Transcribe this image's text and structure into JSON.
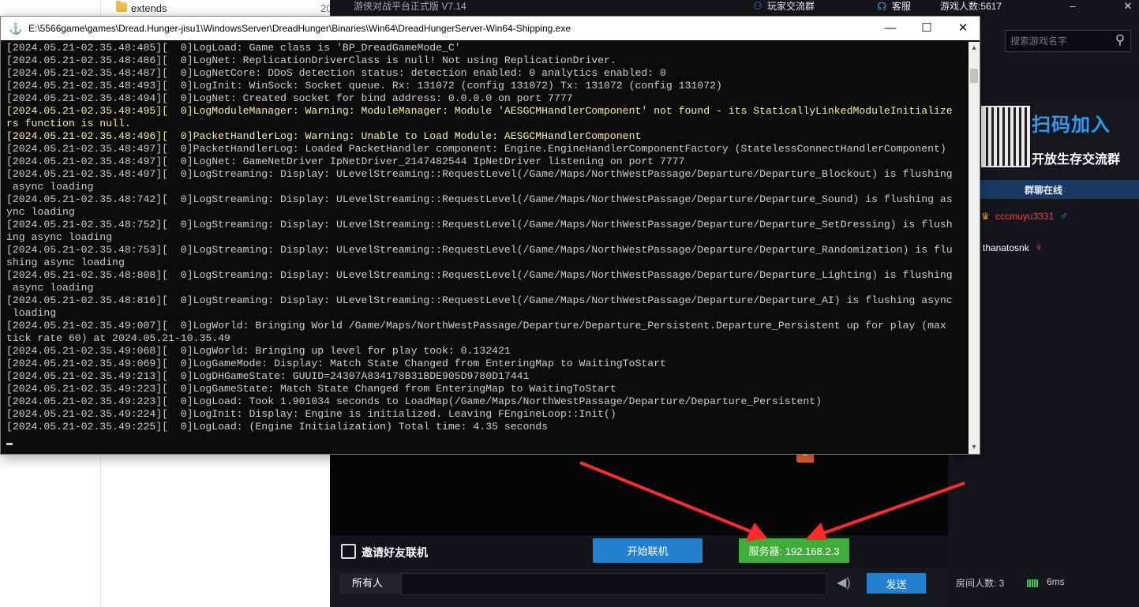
{
  "explorer": {
    "folder_name": "extends",
    "folder_date": "20"
  },
  "platform": {
    "title": "游侠对战平台正式版 V7.14",
    "chat_group": "玩家交流群",
    "service": "客服",
    "players_online": "游戏人数:5617",
    "minimize": "–",
    "close": "✕"
  },
  "right_panel": {
    "search_placeholder": "搜索游戏名字",
    "promo_title": "扫码加入",
    "promo_subtitle": "开放生存交流群",
    "group_online": "群聊在线",
    "members": [
      {
        "name": "cccmuyu3331",
        "gender": "♂",
        "color": "#f04040",
        "badge": "♛"
      },
      {
        "name": "thanatosnk",
        "gender": "♀",
        "color": "#ffffff",
        "badge": ""
      }
    ],
    "room_count": "房间人数: 3",
    "ping": "6ms",
    "logo_letter": "S"
  },
  "actions": {
    "invite": "邀请好友联机",
    "start": "开始联机",
    "server": "服务器: 192.168.2.3",
    "recipient": "所有人",
    "send": "发送"
  },
  "console": {
    "title": "E:\\5566game\\games\\Dread.Hunger-jisu1\\WindowsServer\\DreadHunger\\Binaries\\Win64\\DreadHungerServer-Win64-Shipping.exe",
    "minimize": "—",
    "maximize": "☐",
    "close": "✕",
    "lines": [
      {
        "text": "[2024.05.21-02.35.48:485][  0]LogLoad: Game class is 'BP_DreadGameMode_C'",
        "warn": false
      },
      {
        "text": "[2024.05.21-02.35.48:486][  0]LogNet: ReplicationDriverClass is null! Not using ReplicationDriver.",
        "warn": false
      },
      {
        "text": "[2024.05.21-02.35.48:487][  0]LogNetCore: DDoS detection status: detection enabled: 0 analytics enabled: 0",
        "warn": false
      },
      {
        "text": "[2024.05.21-02.35.48:493][  0]LogInit: WinSock: Socket queue. Rx: 131072 (config 131072) Tx: 131072 (config 131072)",
        "warn": false
      },
      {
        "text": "[2024.05.21-02.35.48:494][  0]LogNet: Created socket for bind address: 0.0.0.0 on port 7777",
        "warn": false
      },
      {
        "text": "[2024.05.21-02.35.48:495][  0]LogModuleManager: Warning: ModuleManager: Module 'AESGCMHandlerComponent' not found - its StaticallyLinkedModuleInitialize",
        "warn": true
      },
      {
        "text": "rs function is null.",
        "warn": true
      },
      {
        "text": "[2024.05.21-02.35.48:496][  0]PacketHandlerLog: Warning: Unable to Load Module: AESGCMHandlerComponent",
        "warn": true
      },
      {
        "text": "[2024.05.21-02.35.48:497][  0]PacketHandlerLog: Loaded PacketHandler component: Engine.EngineHandlerComponentFactory (StatelessConnectHandlerComponent)",
        "warn": false
      },
      {
        "text": "[2024.05.21-02.35.48:497][  0]LogNet: GameNetDriver IpNetDriver_2147482544 IpNetDriver listening on port 7777",
        "warn": false
      },
      {
        "text": "[2024.05.21-02.35.48:497][  0]LogStreaming: Display: ULevelStreaming::RequestLevel(/Game/Maps/NorthWestPassage/Departure/Departure_Blockout) is flushing",
        "warn": false
      },
      {
        "text": " async loading",
        "warn": false
      },
      {
        "text": "[2024.05.21-02.35.48:742][  0]LogStreaming: Display: ULevelStreaming::RequestLevel(/Game/Maps/NorthWestPassage/Departure/Departure_Sound) is flushing as",
        "warn": false
      },
      {
        "text": "ync loading",
        "warn": false
      },
      {
        "text": "[2024.05.21-02.35.48:752][  0]LogStreaming: Display: ULevelStreaming::RequestLevel(/Game/Maps/NorthWestPassage/Departure/Departure_SetDressing) is flush",
        "warn": false
      },
      {
        "text": "ing async loading",
        "warn": false
      },
      {
        "text": "[2024.05.21-02.35.48:753][  0]LogStreaming: Display: ULevelStreaming::RequestLevel(/Game/Maps/NorthWestPassage/Departure/Departure_Randomization) is flu",
        "warn": false
      },
      {
        "text": "shing async loading",
        "warn": false
      },
      {
        "text": "[2024.05.21-02.35.48:808][  0]LogStreaming: Display: ULevelStreaming::RequestLevel(/Game/Maps/NorthWestPassage/Departure/Departure_Lighting) is flushing",
        "warn": false
      },
      {
        "text": " async loading",
        "warn": false
      },
      {
        "text": "[2024.05.21-02.35.48:816][  0]LogStreaming: Display: ULevelStreaming::RequestLevel(/Game/Maps/NorthWestPassage/Departure/Departure_AI) is flushing async",
        "warn": false
      },
      {
        "text": " loading",
        "warn": false
      },
      {
        "text": "[2024.05.21-02.35.49:007][  0]LogWorld: Bringing World /Game/Maps/NorthWestPassage/Departure/Departure_Persistent.Departure_Persistent up for play (max",
        "warn": false
      },
      {
        "text": "tick rate 60) at 2024.05.21-10.35.49",
        "warn": false
      },
      {
        "text": "[2024.05.21-02.35.49:068][  0]LogWorld: Bringing up level for play took: 0.132421",
        "warn": false
      },
      {
        "text": "[2024.05.21-02.35.49:069][  0]LogGameMode: Display: Match State Changed from EnteringMap to WaitingToStart",
        "warn": false
      },
      {
        "text": "[2024.05.21-02.35.49:213][  0]LogDHGameState: GUUID=24307A834178B31BDE905D9780D17441",
        "warn": false
      },
      {
        "text": "[2024.05.21-02.35.49:223][  0]LogGameState: Match State Changed from EnteringMap to WaitingToStart",
        "warn": false
      },
      {
        "text": "[2024.05.21-02.35.49:223][  0]LogLoad: Took 1.901034 seconds to LoadMap(/Game/Maps/NorthWestPassage/Departure/Departure_Persistent)",
        "warn": false
      },
      {
        "text": "[2024.05.21-02.35.49:224][  0]LogInit: Display: Engine is initialized. Leaving FEngineLoop::Init()",
        "warn": false
      },
      {
        "text": "[2024.05.21-02.35.49:225][  0]LogLoad: (Engine Initialization) Total time: 4.35 seconds",
        "warn": false
      }
    ]
  },
  "annotation_color": "#ff2a2a"
}
